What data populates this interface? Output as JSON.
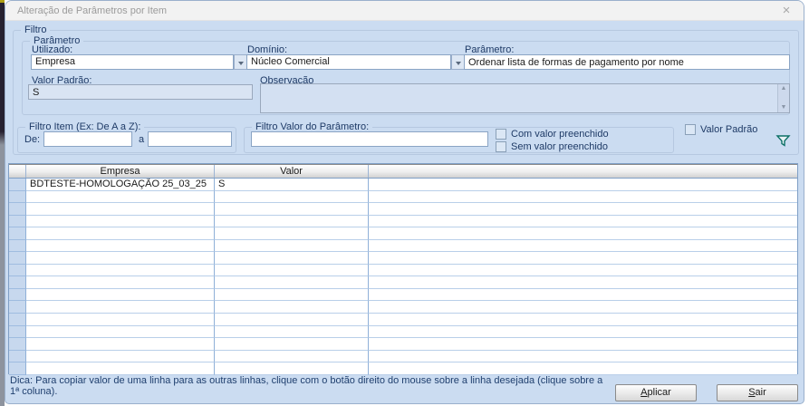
{
  "window": {
    "title": "Alteração de Parâmetros por Item",
    "close_glyph": "×"
  },
  "filtro": {
    "legend": "Filtro",
    "parametro": {
      "legend": "Parâmetro",
      "utilizado_label": "Utilizado:",
      "utilizado_value": "Empresa",
      "dominio_label": "Domínio:",
      "dominio_value": "Núcleo Comercial",
      "parametro_label": "Parâmetro:",
      "parametro_value": "Ordenar lista de formas de pagamento por nome",
      "valor_padrao_label": "Valor Padrão:",
      "valor_padrao_value": "S",
      "observacao_label": "Observação",
      "observacao_value": ""
    },
    "filtro_item": {
      "legend": "Filtro Item (Ex: De A a Z):",
      "de_label": "De:",
      "de_value": "",
      "a_label": "a",
      "a_value": ""
    },
    "filtro_valor": {
      "legend": "Filtro Valor do Parâmetro:",
      "value": "",
      "checkboxes": [
        "Com valor preenchido",
        "Sem valor preenchido"
      ]
    },
    "valor_padrao_checkbox_label": "Valor Padrão",
    "funnel_icon": "filter-funnel"
  },
  "table": {
    "columns": [
      "Empresa",
      "Valor",
      ""
    ],
    "rows": [
      {
        "empresa": "BDTESTE-HOMOLOGAÇÃO 25_03_25",
        "valor": "S"
      }
    ],
    "empty_row_count": 15
  },
  "footer": {
    "hint": "Dica: Para copiar valor de uma linha para as outras linhas, clique com o botão direito do mouse sobre a linha desejada (clique sobre a 1ª coluna).",
    "apply_label": "Aplicar",
    "exit_label": "Sair"
  },
  "colors": {
    "dialog_bg": "#cbdcf1",
    "titlebar_bg": "#f2f2f2",
    "grid_line_h": "#b9cfe9",
    "grid_line_v": "#8fb0d8",
    "funnel": "#0d7066",
    "label_text": "#1e3a66"
  }
}
